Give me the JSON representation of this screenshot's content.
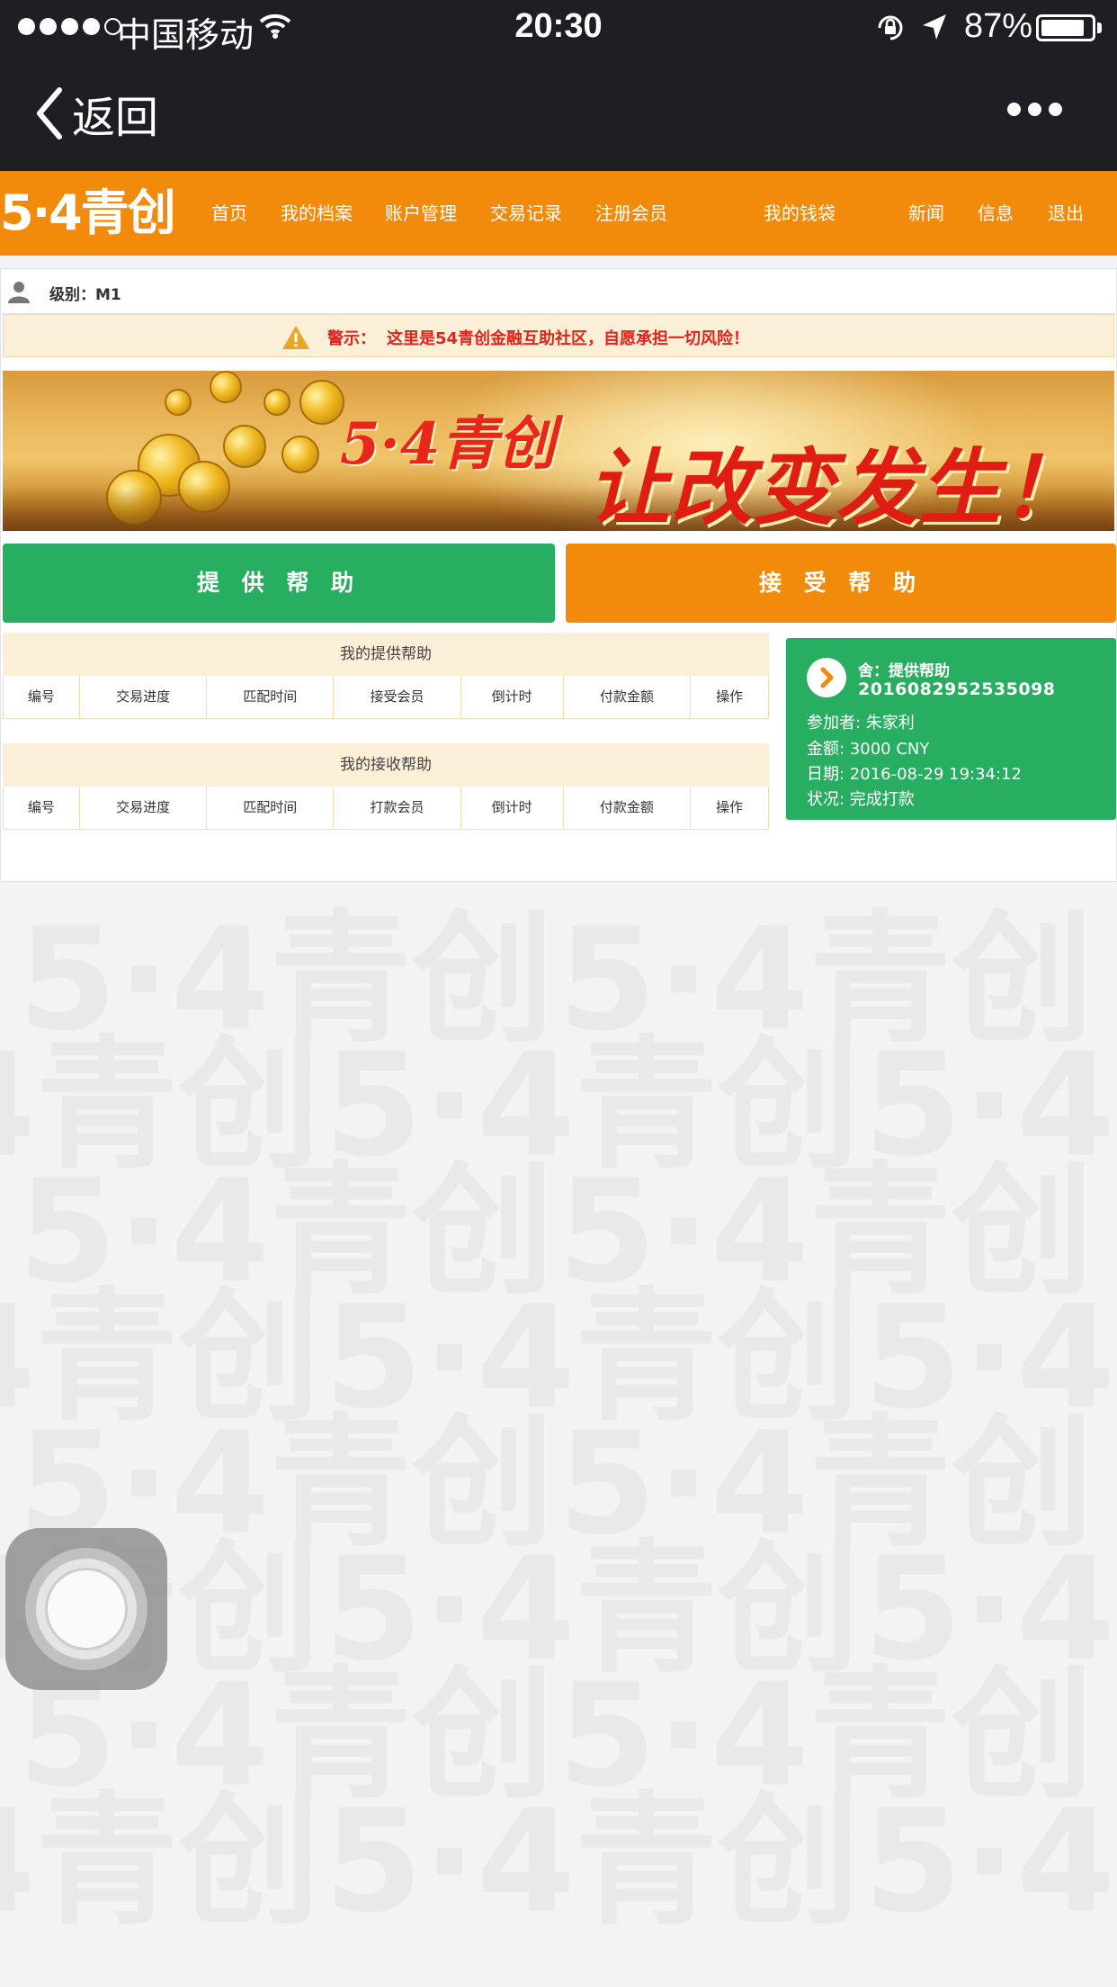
{
  "status_bar": {
    "carrier": "中国移动",
    "time": "20:30",
    "battery_percent": "87%",
    "battery_level": 0.87,
    "signal_bars": 4
  },
  "nav_bar": {
    "back_label": "返回"
  },
  "site_header": {
    "logo_text": "5·4青创",
    "menu": [
      {
        "label": "首页"
      },
      {
        "label": "我的档案"
      },
      {
        "label": "账户管理"
      },
      {
        "label": "交易记录"
      },
      {
        "label": "注册会员"
      },
      {
        "label": "我的钱袋"
      },
      {
        "label": "新闻"
      },
      {
        "label": "信息"
      },
      {
        "label": "退出"
      }
    ]
  },
  "user": {
    "level_label": "级别：M1"
  },
  "warning": {
    "title": "警示：",
    "text": "这里是54青创金融互助社区，自愿承担一切风险！"
  },
  "banner": {
    "brand": "5·4青创",
    "slogan": "让改变发生！"
  },
  "actions": {
    "provide_help": "提 供 帮 助",
    "receive_help": "接 受 帮 助"
  },
  "tables": {
    "provide": {
      "title": "我的提供帮助",
      "columns": [
        "编号",
        "交易进度",
        "匹配时间",
        "接受会员",
        "倒计时",
        "付款金额",
        "操作"
      ]
    },
    "receive": {
      "title": "我的接收帮助",
      "columns": [
        "编号",
        "交易进度",
        "匹配时间",
        "打款会员",
        "倒计时",
        "付款金额",
        "操作"
      ]
    }
  },
  "help_card": {
    "type": "舍：提供帮助",
    "id": "2016082952535098",
    "participant": "参加者: 朱家利",
    "amount": "金额: 3000 CNY",
    "date": "日期: 2016-08-29 19:34:12",
    "status": "状况: 完成打款"
  },
  "colors": {
    "header_dark": "#1e1f25",
    "brand_orange": "#f28a0b",
    "green": "#27ae60",
    "warning_red": "#e2231a",
    "warning_bg": "#fcefd8"
  },
  "watermark_text": "5·4青创"
}
